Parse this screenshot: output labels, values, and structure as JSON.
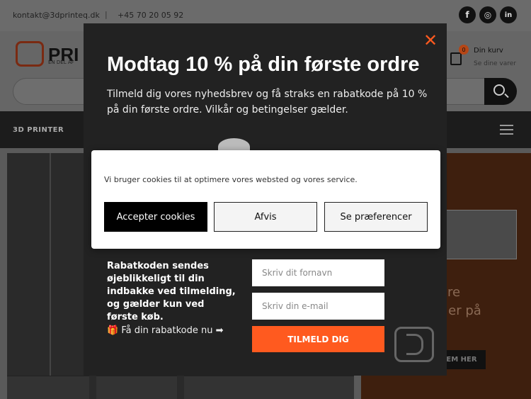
{
  "topbar": {
    "email": "kontakt@3dprinteq.dk",
    "separator": "|",
    "phone": "+45 70 20 05 92",
    "social": [
      {
        "icon": "facebook-icon",
        "glyph": "f"
      },
      {
        "icon": "instagram-icon",
        "glyph": "◎"
      },
      {
        "icon": "linkedin-icon",
        "glyph": "in"
      }
    ]
  },
  "header": {
    "logo_text": "PRI",
    "logo_sub": "EN DEL AF",
    "cart_count": "0",
    "cart_title": "Din kurv",
    "cart_sub": "Se dine varer"
  },
  "nav": {
    "first_item": "3D PRINTER"
  },
  "hero": {
    "text1": "re",
    "text2": "r er på",
    "button": "EM HER"
  },
  "modal": {
    "close": "✕",
    "title": "Modtag 10 % på din første ordre",
    "text": "Tilmeld dig vores nyhedsbrev og få straks en rabatkode på 10 % på din første ordre. Vilkår og betingelser gælder.",
    "info": "Rabatkoden sendes øjeblikkeligt til din indbakke ved tilmelding, og gælder kun ved første køb.",
    "link": "🎁 Få din rabatkode nu ➡",
    "firstname_placeholder": "Skriv dit fornavn",
    "email_placeholder": "Skriv din e-mail",
    "submit": "TILMELD DIG",
    "accent_color": "#ff5a1f"
  },
  "cookie": {
    "text": "Vi bruger cookies til at optimere vores websted og vores service.",
    "accept": "Accepter cookies",
    "decline": "Afvis",
    "preferences": "Se præferencer"
  }
}
